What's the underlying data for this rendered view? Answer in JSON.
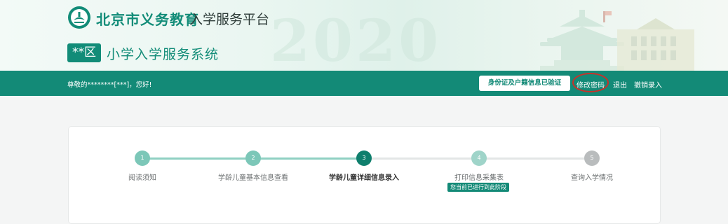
{
  "header": {
    "title_main": "北京市义务教育",
    "title_sub": "入学服务平台",
    "background_year": "2020"
  },
  "system": {
    "district_badge": "**区",
    "title": "小学入学服务系统"
  },
  "topbar": {
    "greeting": "尊敬的********[***]，您好!",
    "verified_badge": "身份证及户籍信息已验证",
    "change_password": "修改密码",
    "logout": "退出",
    "withdraw_entry": "撤销录入"
  },
  "steps": {
    "items": [
      {
        "number": "1",
        "label": "阅读须知",
        "state": "completed"
      },
      {
        "number": "2",
        "label": "学龄儿童基本信息查看",
        "state": "completed"
      },
      {
        "number": "3",
        "label": "学龄儿童详细信息录入",
        "state": "current"
      },
      {
        "number": "4",
        "label": "打印信息采集表",
        "state": "upcoming"
      },
      {
        "number": "5",
        "label": "查询入学情况",
        "state": "inactive"
      }
    ],
    "stage_tag": "您当前已进行到此阶段"
  },
  "colors": {
    "brand": "#138a77",
    "completed_node": "#7cc7b8",
    "current_node": "#0f7f6d",
    "upcoming_node": "#9fd4c9",
    "inactive_node": "#b9bcbd",
    "highlight_ring": "#c8312a"
  }
}
